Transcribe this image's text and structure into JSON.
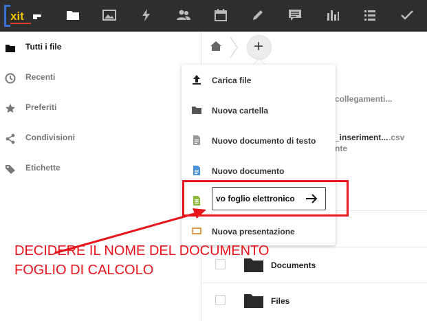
{
  "topbar": {
    "logo_text": "xit",
    "icons": [
      "folder-icon",
      "image-icon",
      "bolt-icon",
      "contacts-icon",
      "calendar-icon",
      "pencil-icon",
      "chat-icon",
      "bar-chart-icon",
      "list-icon",
      "check-icon"
    ]
  },
  "sidebar": {
    "items": [
      {
        "label": "Tutti i file",
        "icon": "folder-icon"
      },
      {
        "label": "Recenti",
        "icon": "clock-icon"
      },
      {
        "label": "Preferiti",
        "icon": "star-icon"
      },
      {
        "label": "Condivisioni",
        "icon": "share-icon"
      },
      {
        "label": "Etichette",
        "icon": "tag-icon"
      }
    ]
  },
  "menu": {
    "items": [
      {
        "label": "Carica file",
        "icon": "upload-icon"
      },
      {
        "label": "Nuova cartella",
        "icon": "folder-icon"
      },
      {
        "label": "Nuovo documento di testo",
        "icon": "text-file-icon"
      },
      {
        "label": "Nuovo documento",
        "icon": "document-icon"
      },
      {
        "label": "Nuovo foglio elettronico",
        "icon": "spreadsheet-icon"
      },
      {
        "label": "Nuova presentazione",
        "icon": "presentation-icon"
      }
    ],
    "rename_value": "vo foglio elettronico"
  },
  "background_fragments": {
    "frag1": "collegamenti...",
    "frag2": "_inseriment...",
    "frag2_ext": ".csv",
    "frag3": "nte"
  },
  "files": [
    {
      "name": "Documents"
    },
    {
      "name": "Files"
    }
  ],
  "annotation": {
    "line1": "DECIDERE IL NOME DEL DOCUMENTO",
    "line2": "FOGLIO DI CALCOLO",
    "color": "#e8141b"
  }
}
